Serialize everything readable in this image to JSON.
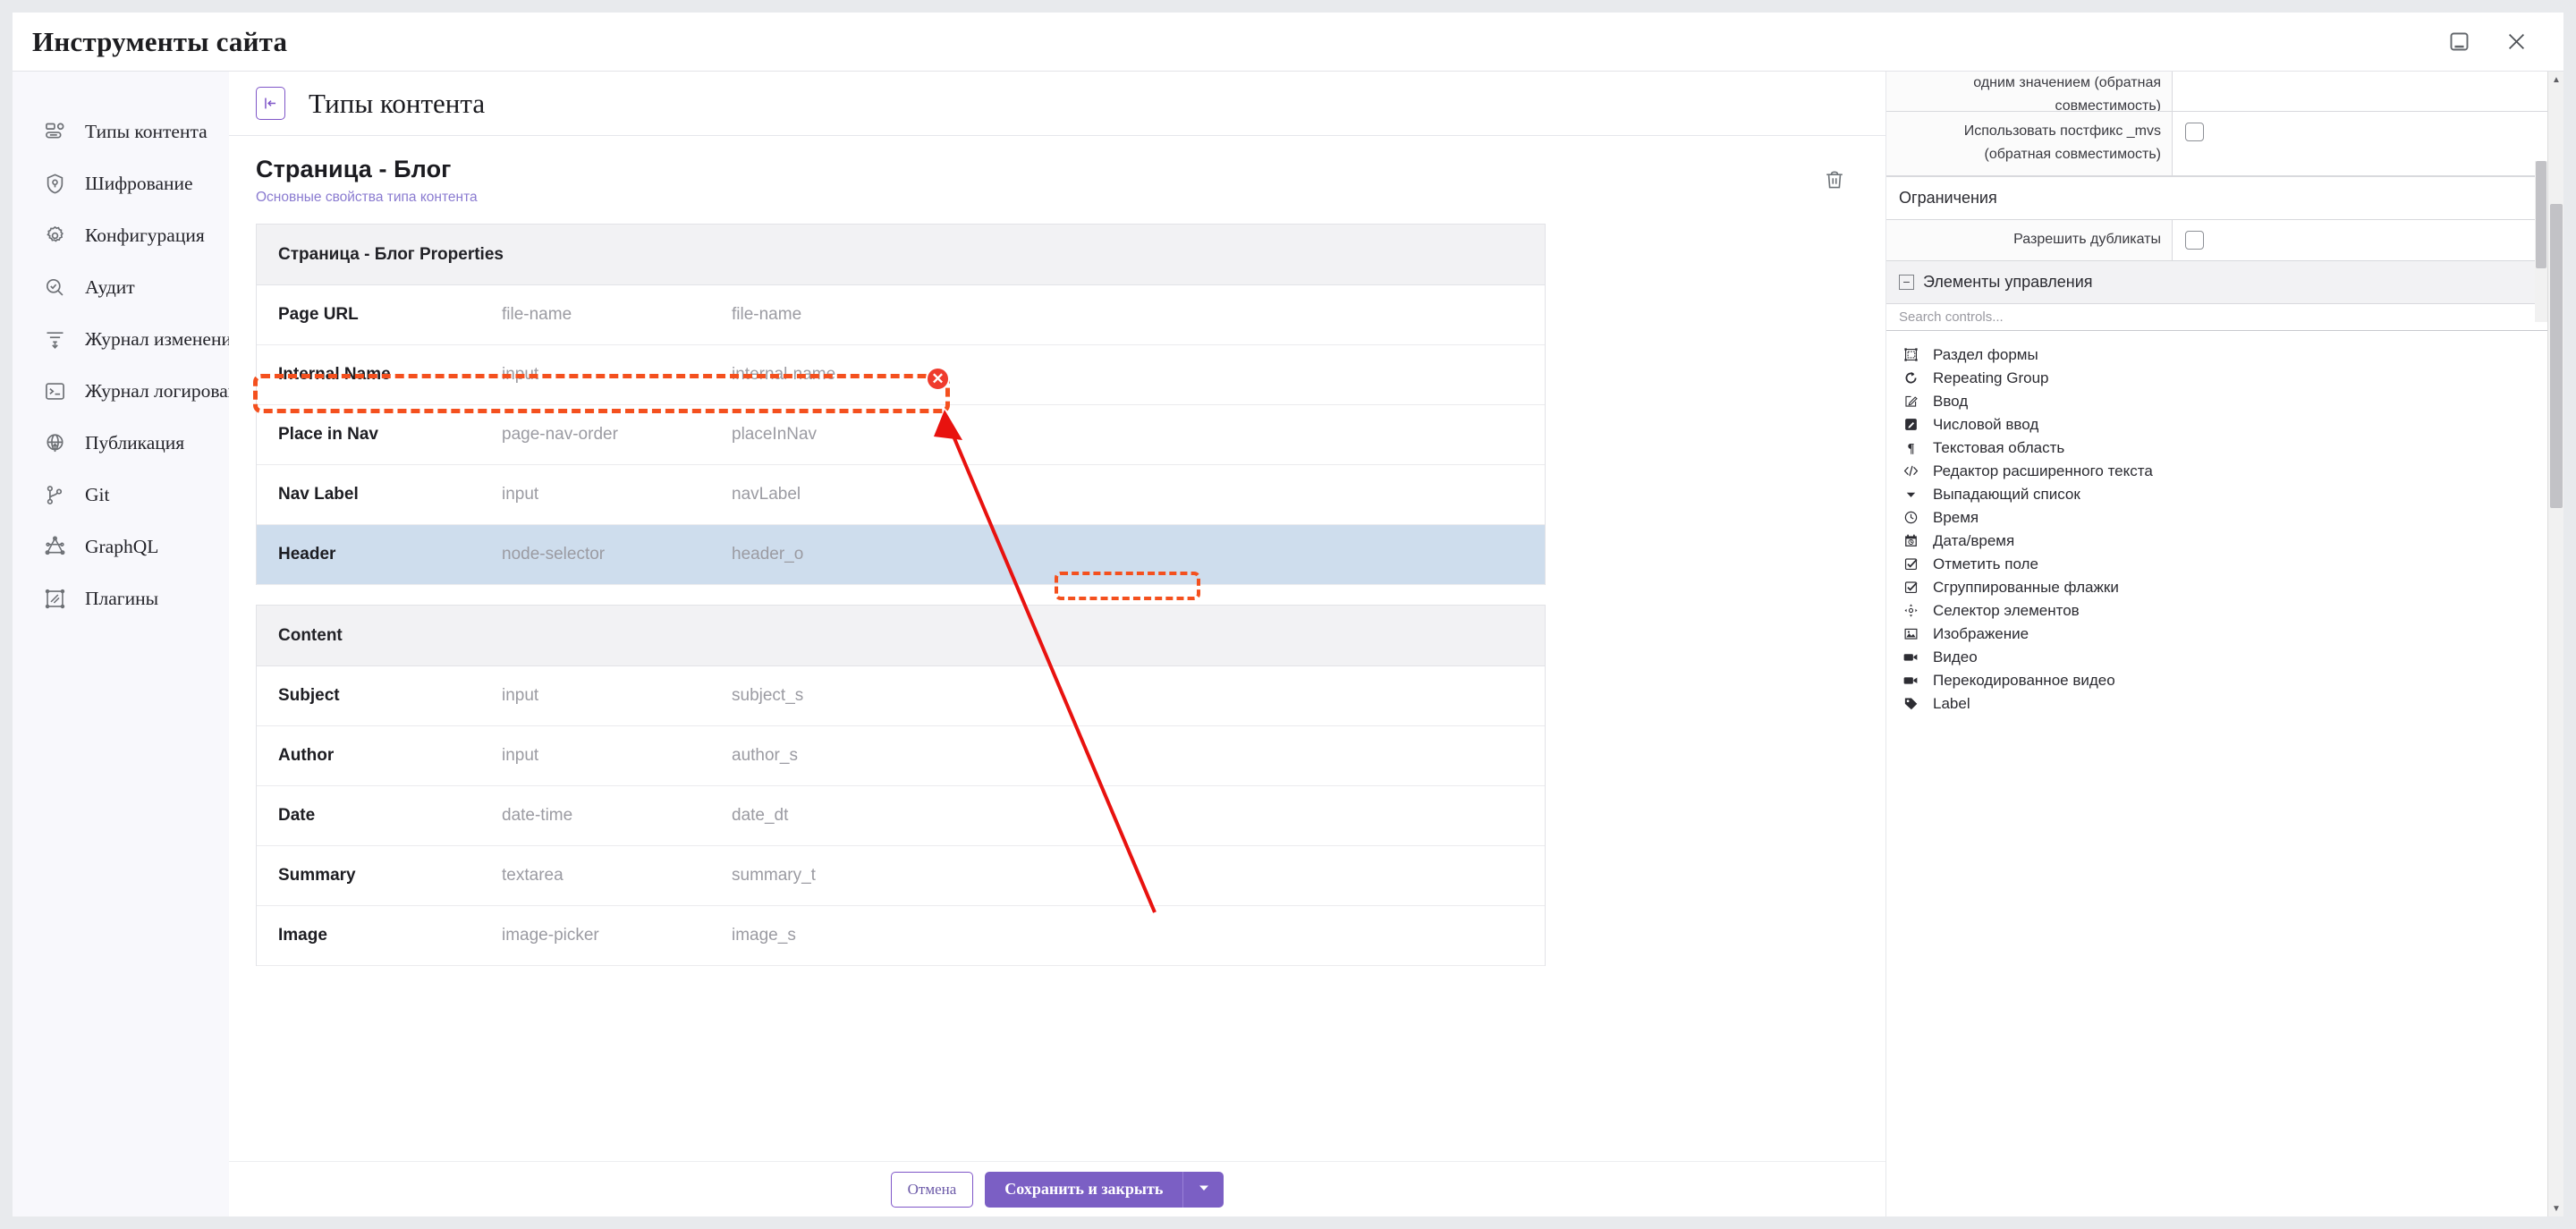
{
  "window": {
    "title": "Инструменты сайта",
    "restore_icon": "restore-window-icon",
    "close_icon": "close-icon"
  },
  "sidebar": {
    "items": [
      {
        "label": "Типы контента",
        "icon": "content-types-icon"
      },
      {
        "label": "Шифрование",
        "icon": "shield-key-icon"
      },
      {
        "label": "Конфигурация",
        "icon": "gear-icon"
      },
      {
        "label": "Аудит",
        "icon": "audit-search-icon"
      },
      {
        "label": "Журнал изменений",
        "icon": "change-log-icon"
      },
      {
        "label": "Журнал логирования",
        "icon": "terminal-log-icon"
      },
      {
        "label": "Публикация",
        "icon": "globe-publish-icon"
      },
      {
        "label": "Git",
        "icon": "git-branch-icon"
      },
      {
        "label": "GraphQL",
        "icon": "graphql-icon"
      },
      {
        "label": "Плагины",
        "icon": "plugins-icon"
      }
    ]
  },
  "breadcrumb": {
    "collapse_icon": "collapse-panel-icon",
    "title": "Типы контента"
  },
  "document": {
    "title": "Страница - Блог",
    "subtitle": "Основные свойства типа контента",
    "delete_icon": "trash-icon",
    "properties_table": {
      "header": "Страница - Блог Properties",
      "rows": [
        {
          "name": "Page URL",
          "type": "file-name",
          "id": "file-name",
          "selected": false
        },
        {
          "name": "Internal Name",
          "type": "input",
          "id": "internal-name",
          "selected": false
        },
        {
          "name": "Place in Nav",
          "type": "page-nav-order",
          "id": "placeInNav",
          "selected": false
        },
        {
          "name": "Nav Label",
          "type": "input",
          "id": "navLabel",
          "selected": false
        },
        {
          "name": "Header",
          "type": "node-selector",
          "id": "header_o",
          "selected": true
        }
      ]
    },
    "content_table": {
      "header": "Content",
      "rows": [
        {
          "name": "Subject",
          "type": "input",
          "id": "subject_s"
        },
        {
          "name": "Author",
          "type": "input",
          "id": "author_s"
        },
        {
          "name": "Date",
          "type": "date-time",
          "id": "date_dt"
        },
        {
          "name": "Summary",
          "type": "textarea",
          "id": "summary_t"
        },
        {
          "name": "Image",
          "type": "image-picker",
          "id": "image_s"
        }
      ]
    }
  },
  "footer": {
    "cancel_label": "Отмена",
    "save_label": "Сохранить и закрыть",
    "save_dropdown_icon": "chevron-down-icon"
  },
  "right_panel": {
    "settings_rows": [
      {
        "label": "одним значением (обратная совместимость)",
        "has_checkbox": false
      },
      {
        "label": "Использовать постфикс _mvs (обратная совместимость)",
        "has_checkbox": true
      }
    ],
    "constraints_section": "Ограничения",
    "constraint_rows": [
      {
        "label": "Разрешить дубликаты",
        "has_checkbox": true
      }
    ],
    "controls_section": "Элементы управления",
    "search_placeholder": "Search controls...",
    "controls": [
      {
        "label": "Раздел формы",
        "icon": "form-section-icon",
        "highlighted": false
      },
      {
        "label": "Repeating Group",
        "icon": "repeat-icon",
        "highlighted": false
      },
      {
        "label": "Ввод",
        "icon": "input-pencil-icon",
        "highlighted": false
      },
      {
        "label": "Числовой ввод",
        "icon": "number-input-icon",
        "highlighted": false
      },
      {
        "label": "Текстовая область",
        "icon": "paragraph-icon",
        "highlighted": false
      },
      {
        "label": "Редактор расширенного текста",
        "icon": "code-icon",
        "highlighted": false
      },
      {
        "label": "Выпадающий список",
        "icon": "dropdown-caret-icon",
        "highlighted": false
      },
      {
        "label": "Время",
        "icon": "clock-icon",
        "highlighted": false
      },
      {
        "label": "Дата/время",
        "icon": "calendar-clock-icon",
        "highlighted": false
      },
      {
        "label": "Отметить поле",
        "icon": "checkbox-icon",
        "highlighted": false
      },
      {
        "label": "Сгруппированные флажки",
        "icon": "checkbox-group-icon",
        "highlighted": false
      },
      {
        "label": "Селектор элементов",
        "icon": "node-selector-icon",
        "highlighted": true
      },
      {
        "label": "Изображение",
        "icon": "image-icon",
        "highlighted": false
      },
      {
        "label": "Видео",
        "icon": "video-icon",
        "highlighted": false
      },
      {
        "label": "Перекодированное видео",
        "icon": "video-transcode-icon",
        "highlighted": false
      },
      {
        "label": "Label",
        "icon": "tag-icon",
        "highlighted": false
      }
    ]
  },
  "annotation": {
    "highlight_color": "#f4501e",
    "arrow_color": "#e8120f",
    "remove_icon": "remove-circle-icon"
  }
}
